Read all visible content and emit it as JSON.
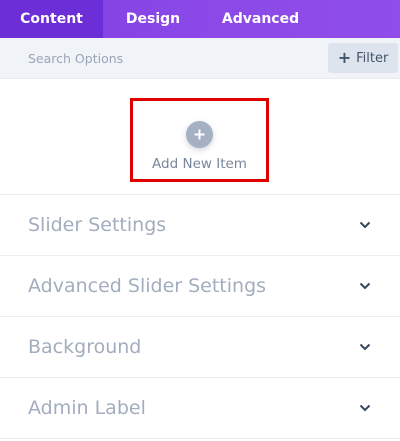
{
  "tabs": [
    {
      "label": "Content",
      "active": true
    },
    {
      "label": "Design",
      "active": false
    },
    {
      "label": "Advanced",
      "active": false
    }
  ],
  "search": {
    "placeholder": "Search Options",
    "value": ""
  },
  "filter": {
    "label": "Filter",
    "icon": "plus-icon"
  },
  "add_item": {
    "label": "Add New Item",
    "icon": "plus-circle-icon"
  },
  "sections": [
    {
      "title": "Slider Settings",
      "icon": "chevron-down-icon"
    },
    {
      "title": "Advanced Slider Settings",
      "icon": "chevron-down-icon"
    },
    {
      "title": "Background",
      "icon": "chevron-down-icon"
    },
    {
      "title": "Admin Label",
      "icon": "chevron-down-icon"
    }
  ],
  "colors": {
    "tab_bar": "#8b48e8",
    "active_tab": "#6c2ed6",
    "highlight_border": "#e10000",
    "section_text": "#a2adbe"
  }
}
